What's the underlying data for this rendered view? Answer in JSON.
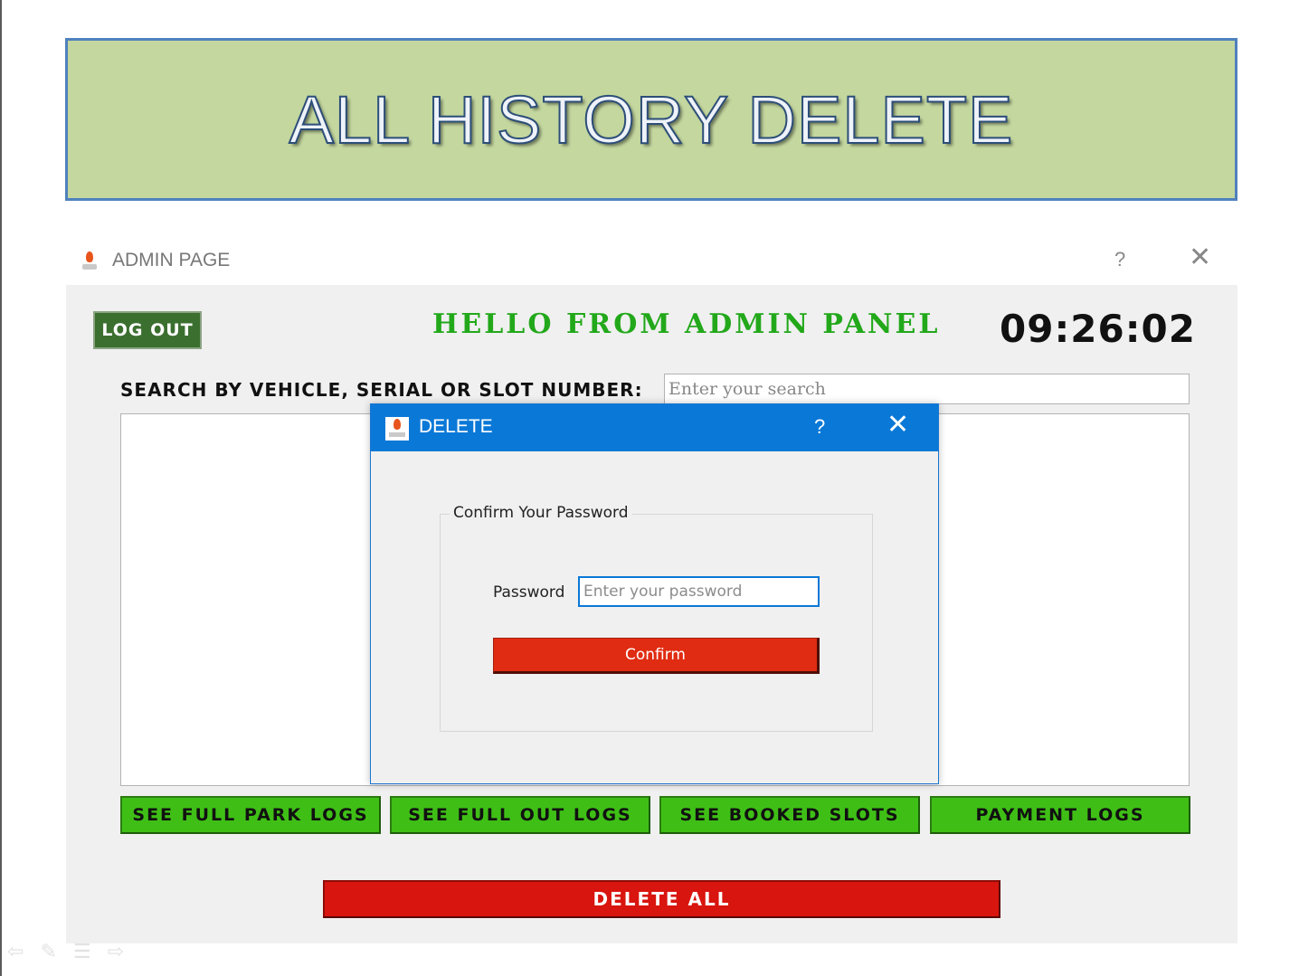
{
  "slide": {
    "title": "ALL HISTORY DELETE"
  },
  "window": {
    "title": "ADMIN PAGE",
    "help": "?",
    "close": "✕"
  },
  "admin": {
    "logout_label": "LOG OUT",
    "greeting": "HELLO FROM ADMIN PANEL",
    "clock": "09:26:02",
    "search_label": "SEARCH BY VEHICLE, SERIAL OR SLOT NUMBER:",
    "search_placeholder": "Enter your search",
    "buttons": [
      {
        "label": "SEE FULL PARK LOGS"
      },
      {
        "label": "SEE FULL OUT LOGS"
      },
      {
        "label": "SEE BOOKED SLOTS"
      },
      {
        "label": "PAYMENT LOGS"
      }
    ],
    "delete_all_label": "DELETE ALL"
  },
  "dialog": {
    "title": "DELETE",
    "help": "?",
    "close": "✕",
    "group_title": "Confirm Your Password",
    "password_label": "Password",
    "password_placeholder": "Enter your password",
    "confirm_label": "Confirm"
  },
  "nav": {
    "prev": "⇦",
    "pen": "✎",
    "menu": "☰",
    "next": "⇨"
  },
  "colors": {
    "banner_bg": "#c4d79f",
    "banner_border": "#4f81bd",
    "logout_bg": "#3b6f2f",
    "greeting": "#22a81a",
    "log_button_bg": "#3fbf16",
    "delete_all_bg": "#d8150e",
    "dialog_titlebar": "#0a78d7",
    "confirm_bg": "#e02c12"
  }
}
